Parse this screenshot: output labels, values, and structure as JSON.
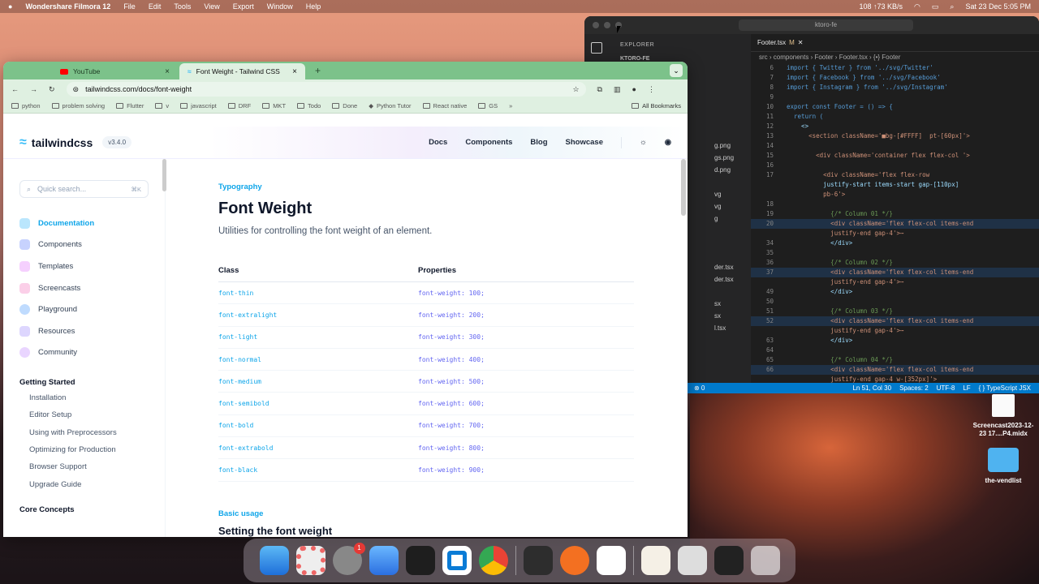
{
  "menubar": {
    "app": "Wondershare Filmora 12",
    "items": [
      "File",
      "Edit",
      "Tools",
      "View",
      "Export",
      "Window",
      "Help"
    ],
    "net": "108 ↑73 KB/s",
    "datetime": "Sat 23 Dec  5:05 PM"
  },
  "vscode": {
    "search": "ktoro-fe",
    "explorer_label": "EXPLORER",
    "root": "KTORO-FE",
    "files": [
      "g.png",
      "gs.png",
      "d.png",
      "vg",
      "vg",
      "g",
      "",
      "",
      "M",
      "",
      "",
      "der.tsx",
      "der.tsx",
      "",
      "sx",
      "sx",
      "l.tsx"
    ],
    "tab": "Footer.tsx",
    "tab_mod": "M",
    "breadcrumb": "src › components › Footer › Footer.tsx › {•} Footer",
    "lines": [
      {
        "n": "6",
        "t": "import { Twitter } from '../svg/Twitter'"
      },
      {
        "n": "7",
        "t": "import { Facebook } from '../svg/Facebook'"
      },
      {
        "n": "8",
        "t": "import { Instagram } from '../svg/Instagram'"
      },
      {
        "n": "9",
        "t": ""
      },
      {
        "n": "10",
        "t": "export const Footer = () => {"
      },
      {
        "n": "11",
        "t": "  return ("
      },
      {
        "n": "12",
        "t": "    <>"
      },
      {
        "n": "13",
        "t": "      <section className='■bg-[#FFFF]  pt-[60px]'>"
      },
      {
        "n": "14",
        "t": ""
      },
      {
        "n": "15",
        "t": "        <div className='container flex flex-col '>"
      },
      {
        "n": "16",
        "t": ""
      },
      {
        "n": "17",
        "t": "          <div className='flex flex-row"
      },
      {
        "n": "",
        "t": "          justify-start items-start gap-[110px]"
      },
      {
        "n": "",
        "t": "          pb-6'>"
      },
      {
        "n": "18",
        "t": ""
      },
      {
        "n": "19",
        "t": "            {/* Column 01 */}"
      },
      {
        "n": "20",
        "t": "            <div className='flex flex-col items-end"
      },
      {
        "n": "",
        "t": "            justify-end gap-4'>⋯"
      },
      {
        "n": "34",
        "t": "            </div>"
      },
      {
        "n": "35",
        "t": ""
      },
      {
        "n": "36",
        "t": "            {/* Column 02 */}"
      },
      {
        "n": "37",
        "t": "            <div className='flex flex-col items-end"
      },
      {
        "n": "",
        "t": "            justify-end gap-4'>⋯"
      },
      {
        "n": "49",
        "t": "            </div>"
      },
      {
        "n": "50",
        "t": ""
      },
      {
        "n": "51",
        "t": "            {/* Column 03 */}"
      },
      {
        "n": "52",
        "t": "            <div className='flex flex-col items-end"
      },
      {
        "n": "",
        "t": "            justify-end gap-4'>⋯"
      },
      {
        "n": "63",
        "t": "            </div>"
      },
      {
        "n": "64",
        "t": ""
      },
      {
        "n": "65",
        "t": "            {/* Column 04 */}"
      },
      {
        "n": "66",
        "t": "            <div className='flex flex-col items-end"
      },
      {
        "n": "",
        "t": "            justify-end gap-4 w-[352px]'>"
      }
    ],
    "status": {
      "errors": "⊗ 0",
      "pos": "Ln 51, Col 30",
      "spaces": "Spaces: 2",
      "enc": "UTF-8",
      "eol": "LF",
      "lang": "{ } TypeScript JSX"
    }
  },
  "chrome": {
    "tabs": [
      {
        "title": "YouTube"
      },
      {
        "title": "Font Weight - Tailwind CSS"
      }
    ],
    "url": "tailwindcss.com/docs/font-weight",
    "bookmarks": [
      "python",
      "problem solving",
      "Flutter",
      "v",
      "javascript",
      "DRF",
      "MKT",
      "Todo",
      "Done",
      "Python Tutor",
      "React native",
      "GS"
    ],
    "all_bookmarks": "All Bookmarks"
  },
  "page": {
    "logo": "tailwindcss",
    "version": "v3.4.0",
    "nav": [
      "Docs",
      "Components",
      "Blog",
      "Showcase"
    ],
    "search_placeholder": "Quick search...",
    "search_kbd": "⌘K",
    "sidebar_main": [
      "Documentation",
      "Components",
      "Templates",
      "Screencasts",
      "Playground",
      "Resources",
      "Community"
    ],
    "section1": "Getting Started",
    "section1_items": [
      "Installation",
      "Editor Setup",
      "Using with Preprocessors",
      "Optimizing for Production",
      "Browser Support",
      "Upgrade Guide"
    ],
    "section2": "Core Concepts",
    "eyebrow": "Typography",
    "title": "Font Weight",
    "lead": "Utilities for controlling the font weight of an element.",
    "table_headers": [
      "Class",
      "Properties"
    ],
    "rows": [
      [
        "font-thin",
        "font-weight: 100;"
      ],
      [
        "font-extralight",
        "font-weight: 200;"
      ],
      [
        "font-light",
        "font-weight: 300;"
      ],
      [
        "font-normal",
        "font-weight: 400;"
      ],
      [
        "font-medium",
        "font-weight: 500;"
      ],
      [
        "font-semibold",
        "font-weight: 600;"
      ],
      [
        "font-bold",
        "font-weight: 700;"
      ],
      [
        "font-extrabold",
        "font-weight: 800;"
      ],
      [
        "font-black",
        "font-weight: 900;"
      ]
    ],
    "basic_usage": "Basic usage",
    "setting_title": "Setting the font weight"
  },
  "desktop": {
    "file_label": "Screencast2023-12-23 17....P4.midx",
    "folder_label": "the-vendlist"
  },
  "dock": {
    "badge": "1"
  }
}
